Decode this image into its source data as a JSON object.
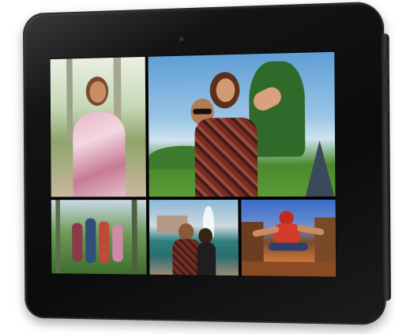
{
  "scene": {
    "device": "tablet",
    "screen_content": "photo collage",
    "photos": [
      {
        "id": "photo-woman-floral-dress"
      },
      {
        "id": "photo-couple-piggyback"
      },
      {
        "id": "photo-group-forest"
      },
      {
        "id": "photo-couple-fountain"
      },
      {
        "id": "photo-jumping-man-street"
      }
    ]
  },
  "colors": {
    "bezel": "#0b0b0b",
    "sky": "#5f9ed6",
    "grass": "#4a8a2d"
  }
}
